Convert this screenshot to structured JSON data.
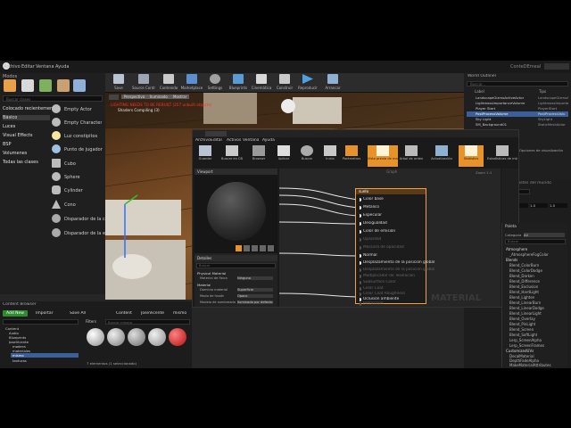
{
  "menu": [
    "Archivo",
    "Editar",
    "Ventana",
    "Ayuda"
  ],
  "project_tab": "ConteDEmeal",
  "modes_title": "Modos",
  "search_placeholder": "Buscar clases",
  "categories": [
    "Colocado recientemente",
    "Básico",
    "Luces",
    "Visual Effects",
    "BSP",
    "Volumenes",
    "Todas las clases"
  ],
  "place_items": [
    "Empty Actor",
    "Empty Character",
    "Luz constipitos",
    "Punto de jugador",
    "Cubo",
    "Sphere",
    "Cylinder",
    "Cono",
    "Disparador de la c",
    "Disparador de la e"
  ],
  "toolbar": [
    "Save",
    "Source Control",
    "Contenido",
    "Marketplace",
    "Settings",
    "Blueprints",
    "Cinemática",
    "Construir",
    "Reproducir",
    "Arrancar"
  ],
  "viewport": {
    "warning": "LIGHTING NEEDS TO BE REBUILT (257 unbuilt objects)",
    "shaders": "Shaders Compiling (3)",
    "buttons": [
      "Perspectiva",
      "Iluminado",
      "Mostrar"
    ],
    "stats": "10 10 10 0"
  },
  "outliner": {
    "title": "World Outliner",
    "search_placeholder": "Buscar...",
    "col_label": "Label",
    "col_type": "Tipo",
    "rows": [
      {
        "label": "LandscapeGizmoActiveActor",
        "type": "LandscapeGizmoA"
      },
      {
        "label": "LightmassImportanceVolume",
        "type": "LightmassImporta"
      },
      {
        "label": "Player Start",
        "type": "PlayerStart"
      },
      {
        "label": "PostProcessVolume",
        "type": "PostProcessVolu"
      },
      {
        "label": "Sky Light",
        "type": "SkyLight"
      },
      {
        "label": "SM_Background01",
        "type": "StaticMeshActor"
      }
    ],
    "footer": "[84 actors] (1 seleccionado)",
    "view_options": "Opciones de visualización"
  },
  "details": {
    "title": "Detalles",
    "world_settings": "Ajustes del mundo",
    "actor_name": "PostProcessVolume",
    "transform_values": [
      "1.0",
      "1.0",
      "1.0"
    ],
    "sections": [
      "Brush Settings",
      "Settings"
    ],
    "rows": [
      "Priority",
      "Blend Radius",
      "Blend Weight",
      "Enabled",
      "Unbound"
    ],
    "priority_value": "0.0",
    "blend_radius_value": "100.0",
    "blend_weight_value": "1.0",
    "brush_label": "Brush Shape"
  },
  "content_browser": {
    "tab": "Content Browser",
    "add_new": "Add New",
    "import": "Importar",
    "save_all": "Save All",
    "path": [
      "Content",
      "JoseVicente",
      "mismo"
    ],
    "filters": "Filters",
    "search_placeholder": "Buscar mismo",
    "tree": [
      "Content",
      "Audio",
      "Blueprints",
      "JoseVicente",
      "madera",
      "materiales",
      "mismo",
      "texturas"
    ],
    "status": "7 elementos (1 seleccionado)"
  },
  "material_editor": {
    "title": "suelo",
    "menu": [
      "Archivo",
      "Editar",
      "Activos",
      "Ventana",
      "Ayuda"
    ],
    "toolbar": [
      "Guardar",
      "Buscar en CB",
      "Browser",
      "Aplicar",
      "Buscar",
      "Inicio",
      "Parámetros",
      "Vista previa de material",
      "Árbol de orden",
      "Actualización",
      "Statistics",
      "Estadísticas de móviles"
    ],
    "viewport_label": "Viewport",
    "graph_label": "Graph",
    "details_tab": "Detalles",
    "details_search": "Buscar",
    "details_sections": [
      "Physical Material",
      "Material"
    ],
    "details_rows": [
      {
        "label": "Material de física",
        "value": "Ninguno"
      },
      {
        "label": "Dominio material",
        "value": "Superficie"
      },
      {
        "label": "Modo de fusión",
        "value": "Opaco"
      },
      {
        "label": "Modelo de sombreado",
        "value": "Iluminado por defecto"
      }
    ],
    "node_title": "suelo",
    "pins": [
      {
        "label": "Color base",
        "on": true
      },
      {
        "label": "Metalico",
        "on": true
      },
      {
        "label": "Especular",
        "on": true
      },
      {
        "label": "Desigualdad",
        "on": true
      },
      {
        "label": "Color de emisión",
        "on": false
      },
      {
        "label": "Opacidad",
        "on": false
      },
      {
        "label": "Máscara de opacidad",
        "on": false
      },
      {
        "label": "Normal",
        "on": true
      },
      {
        "label": "Desplazamiento de la posición global",
        "on": false
      },
      {
        "label": "Desplazamiento de la posición global",
        "on": false
      },
      {
        "label": "Multiplicador de Teselación",
        "on": false
      },
      {
        "label": "Subsurface Color",
        "on": false
      },
      {
        "label": "Clear Coat",
        "on": false
      },
      {
        "label": "Clear Coat Roughness",
        "on": false
      },
      {
        "label": "Oclusión ambiente",
        "on": true
      },
      {
        "label": "Refracción",
        "on": false
      }
    ],
    "watermark": "MATERIAL",
    "zoom": "Zoom 1:1"
  },
  "palette": {
    "title": "Paleta",
    "category_label": "Categoría",
    "category_value": "All",
    "search_placeholder": "Buscar",
    "items": [
      "Atmosphere",
      "_AtmosphereFogColor",
      "Blends",
      "Blend_ColorBurn",
      "Blend_ColorDodge",
      "Blend_Darken",
      "Blend_Difference",
      "Blend_Exclusion",
      "Blend_HardLight",
      "Blend_Lighten",
      "Blend_LinearBurn",
      "Blend_LinearDodge",
      "Blend_LinearLight",
      "Blend_Overlay",
      "Blend_PinLight",
      "Blend_Screen",
      "Blend_SoftLight",
      "Lerp_ScreenAlpha",
      "Lerp_ScreenFrames",
      "CustomizedUVs",
      "DecalMaterial",
      "DepthFadeAlpha",
      "MakeMaterialAttributes"
    ]
  },
  "colors": {
    "accent_orange": "#e8922a",
    "node_border": "#f0a040",
    "selected_row": "#3a5f9a",
    "add_new_green": "#2e8b2e",
    "warning_red": "#ff3030"
  }
}
